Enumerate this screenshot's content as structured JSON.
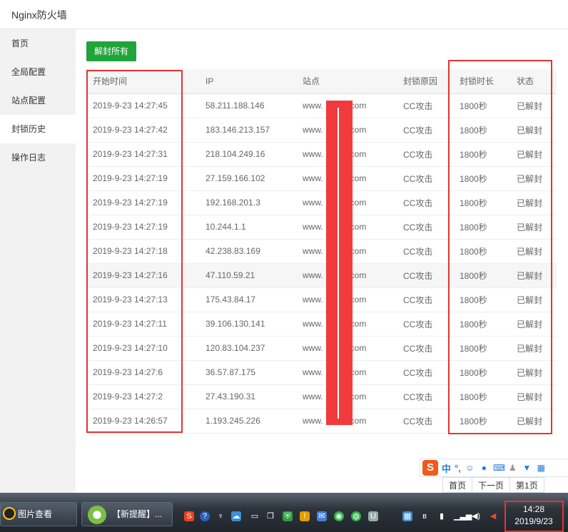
{
  "window": {
    "title": "Nginx防火墙"
  },
  "sidebar": {
    "items": [
      {
        "label": "首页"
      },
      {
        "label": "全局配置"
      },
      {
        "label": "站点配置"
      },
      {
        "label": "封锁历史"
      },
      {
        "label": "操作日志"
      }
    ]
  },
  "main": {
    "unblock_all_label": "解封所有",
    "table": {
      "headers": [
        "开始时间",
        "IP",
        "站点",
        "封锁原因",
        "封锁时长",
        "状态"
      ],
      "rows": [
        {
          "time": "2019-9-23 14:27:45",
          "ip": "58.211.188.146",
          "site": "www.",
          "site_suffix": "com",
          "reason": "CC攻击",
          "duration": "1800秒",
          "status": "已解封"
        },
        {
          "time": "2019-9-23 14:27:42",
          "ip": "183.146.213.157",
          "site": "www.",
          "site_suffix": "com",
          "reason": "CC攻击",
          "duration": "1800秒",
          "status": "已解封"
        },
        {
          "time": "2019-9-23 14:27:31",
          "ip": "218.104.249.16",
          "site": "www.",
          "site_suffix": "com",
          "reason": "CC攻击",
          "duration": "1800秒",
          "status": "已解封"
        },
        {
          "time": "2019-9-23 14:27:19",
          "ip": "27.159.166.102",
          "site": "www.",
          "site_suffix": "com",
          "reason": "CC攻击",
          "duration": "1800秒",
          "status": "已解封"
        },
        {
          "time": "2019-9-23 14:27:19",
          "ip": "192.168.201.3",
          "site": "www.",
          "site_suffix": "com",
          "reason": "CC攻击",
          "duration": "1800秒",
          "status": "已解封"
        },
        {
          "time": "2019-9-23 14:27:19",
          "ip": "10.244.1.1",
          "site": "www.",
          "site_suffix": "com",
          "reason": "CC攻击",
          "duration": "1800秒",
          "status": "已解封"
        },
        {
          "time": "2019-9-23 14:27:18",
          "ip": "42.238.83.169",
          "site": "www.",
          "site_suffix": "com",
          "reason": "CC攻击",
          "duration": "1800秒",
          "status": "已解封"
        },
        {
          "time": "2019-9-23 14:27:16",
          "ip": "47.110.59.21",
          "site": "www.",
          "site_suffix": "com",
          "reason": "CC攻击",
          "duration": "1800秒",
          "status": "已解封"
        },
        {
          "time": "2019-9-23 14:27:13",
          "ip": "175.43.84.17",
          "site": "www.",
          "site_suffix": "com",
          "reason": "CC攻击",
          "duration": "1800秒",
          "status": "已解封"
        },
        {
          "time": "2019-9-23 14:27:11",
          "ip": "39.106.130.141",
          "site": "www.",
          "site_suffix": "com",
          "reason": "CC攻击",
          "duration": "1800秒",
          "status": "已解封"
        },
        {
          "time": "2019-9-23 14:27:10",
          "ip": "120.83.104.237",
          "site": "www.",
          "site_suffix": "com",
          "reason": "CC攻击",
          "duration": "1800秒",
          "status": "已解封"
        },
        {
          "time": "2019-9-23 14:27:6",
          "ip": "36.57.87.175",
          "site": "www.",
          "site_suffix": "com",
          "reason": "CC攻击",
          "duration": "1800秒",
          "status": "已解封"
        },
        {
          "time": "2019-9-23 14:27:2",
          "ip": "27.43.190.31",
          "site": "www.",
          "site_suffix": "com",
          "reason": "CC攻击",
          "duration": "1800秒",
          "status": "已解封"
        },
        {
          "time": "2019-9-23 14:26:57",
          "ip": "1.193.245.226",
          "site": "www.",
          "site_suffix": "com",
          "reason": "CC攻击",
          "duration": "1800秒",
          "status": "已解封"
        }
      ]
    },
    "pager": {
      "first": "首页",
      "next": "下一页",
      "current": "第1页"
    }
  },
  "ime": {
    "logo": "S",
    "mode": "中",
    "punct": "°,"
  },
  "taskbar": {
    "tasks": [
      {
        "label": "图片查看"
      },
      {
        "label": "【新提醒】..."
      }
    ],
    "clock_time": "14:28",
    "clock_date": "2019/9/23"
  },
  "colors": {
    "accent_green": "#20a53a",
    "annotation_red": "#e53333",
    "redaction_red": "#f23a3c",
    "ime_orange": "#f05a1a"
  }
}
